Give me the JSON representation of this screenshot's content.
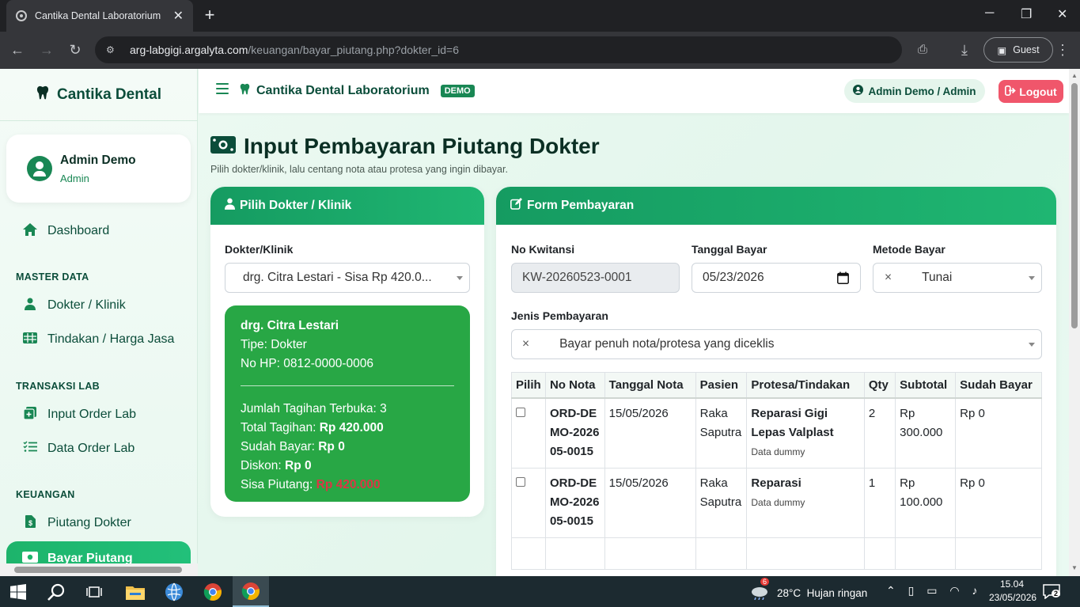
{
  "browser": {
    "tab_title": "Cantika Dental Laboratorium",
    "url_domain": "arg-labgigi.argalyta.com",
    "url_path": "/keuangan/bayar_piutang.php?dokter_id=6",
    "profile": "Guest"
  },
  "sidebar": {
    "brand": "Cantika Dental",
    "user_name": "Admin Demo",
    "user_role": "Admin",
    "dashboard": "Dashboard",
    "sec_master": "MASTER DATA",
    "dokter": "Dokter / Klinik",
    "tindakan": "Tindakan / Harga Jasa",
    "sec_transaksi": "TRANSAKSI LAB",
    "input_order": "Input Order Lab",
    "data_order": "Data Order Lab",
    "sec_keuangan": "KEUANGAN",
    "piutang": "Piutang Dokter",
    "bayar": "Bayar Piutang"
  },
  "topbar": {
    "brand": "Cantika Dental Laboratorium",
    "badge": "DEMO",
    "user": "Admin Demo / Admin",
    "logout": "Logout"
  },
  "page": {
    "title": "Input Pembayaran Piutang Dokter",
    "subtitle": "Pilih dokter/klinik, lalu centang nota atau protesa yang ingin dibayar."
  },
  "left_card": {
    "header": "Pilih Dokter / Klinik",
    "label": "Dokter/Klinik",
    "selected": "drg. Citra Lestari - Sisa Rp 420.0...",
    "info": {
      "name": "drg. Citra Lestari",
      "tipe": "Tipe: Dokter",
      "hp": "No HP: 0812-0000-0006",
      "jumlah": "Jumlah Tagihan Terbuka: 3",
      "total_label": "Total Tagihan: ",
      "total_value": "Rp 420.000",
      "sudah_label": "Sudah Bayar: ",
      "sudah_value": "Rp 0",
      "diskon_label": "Diskon: ",
      "diskon_value": "Rp 0",
      "sisa_label": "Sisa Piutang: ",
      "sisa_value": "Rp 420.000"
    }
  },
  "form": {
    "header": "Form Pembayaran",
    "kwitansi_label": "No Kwitansi",
    "kwitansi_value": "KW-20260523-0001",
    "tanggal_label": "Tanggal Bayar",
    "tanggal_value": "05/23/2026",
    "metode_label": "Metode Bayar",
    "metode_value": "Tunai",
    "jenis_label": "Jenis Pembayaran",
    "jenis_value": "Bayar penuh nota/protesa yang diceklis",
    "clear_glyph": "×"
  },
  "table": {
    "headers": [
      "Pilih",
      "No Nota",
      "Tanggal Nota",
      "Pasien",
      "Protesa/Tindakan",
      "Qty",
      "Subtotal",
      "Sudah Bayar"
    ],
    "rows": [
      {
        "nota": "ORD-DEMO-202605-0015",
        "tanggal": "15/05/2026",
        "pasien": "Raka Saputra",
        "tindakan": "Reparasi Gigi Lepas Valplast",
        "note": "Data dummy",
        "qty": "2",
        "subtotal": "Rp 300.000",
        "sudah": "Rp 0"
      },
      {
        "nota": "ORD-DEMO-202605-0015",
        "tanggal": "15/05/2026",
        "pasien": "Raka Saputra",
        "tindakan": "Reparasi",
        "note": "Data dummy",
        "qty": "1",
        "subtotal": "Rp 100.000",
        "sudah": "Rp 0"
      }
    ]
  },
  "taskbar": {
    "weather": "28°C  Hujan ringan",
    "weather_badge": "6",
    "time": "15.04",
    "date": "23/05/2026",
    "notif": "2"
  }
}
